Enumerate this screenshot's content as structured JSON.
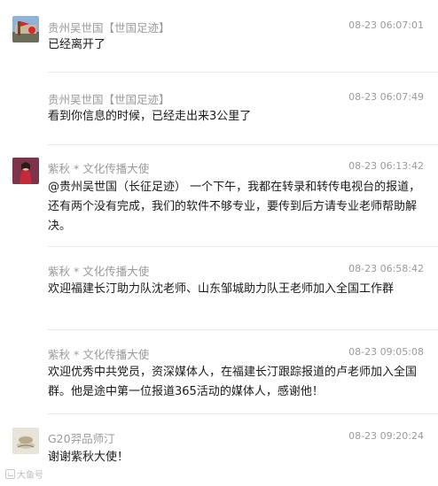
{
  "messages": [
    {
      "sender": "贵州吴世国【世国足迹】",
      "time": "08-23 06:07:01",
      "text": "已经离开了",
      "avatar": "flag-avatar"
    },
    {
      "sender": "贵州吴世国【世国足迹】",
      "time": "08-23 06:07:49",
      "text": "看到你信息的时候，已经走出来3公里了",
      "avatar": ""
    },
    {
      "sender": "紫秋 * 文化传播大使",
      "time": "08-23 06:13:42",
      "text": "@贵州吴世国（长征足迹） 一个下午，我都在转录和转传电视台的报道，还有两个没有完成，我们的软件不够专业，要传到后方请专业老师帮助解决。",
      "avatar": "person-avatar"
    },
    {
      "sender": "紫秋 * 文化传播大使",
      "time": "08-23 06:58:42",
      "text": "欢迎福建长汀助力队沈老师、山东邹城助力队王老师加入全国工作群",
      "avatar": ""
    },
    {
      "sender": "紫秋 * 文化传播大使",
      "time": "08-23 09:05:08",
      "text": "欢迎优秀中共党员，资深媒体人，在福建长汀跟踪报道的卢老师加入全国群。他是途中第一位报道365活动的媒体人，感谢他！",
      "avatar": ""
    },
    {
      "sender": "G20羿品师汀",
      "time": "08-23 09:20:24",
      "text": "谢谢紫秋大使！",
      "avatar": "tea-avatar"
    }
  ],
  "watermark": "大鱼号"
}
